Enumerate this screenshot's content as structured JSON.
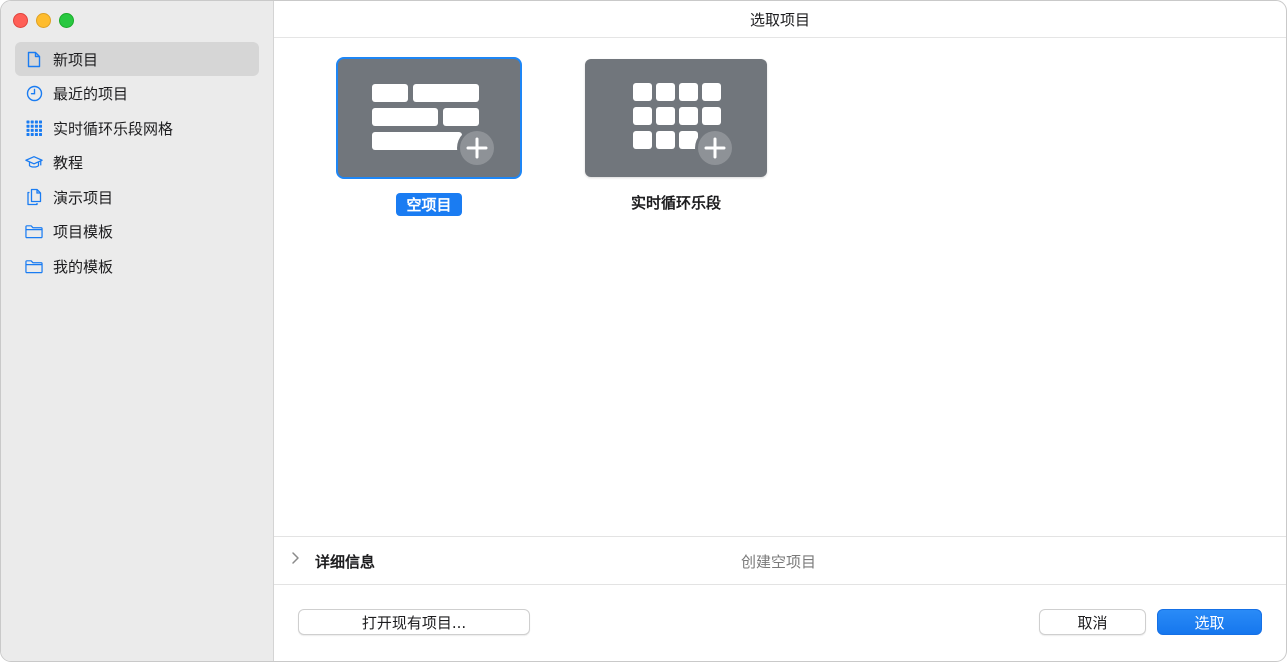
{
  "window": {
    "title": "选取项目"
  },
  "sidebar": {
    "items": [
      {
        "label": "新项目",
        "icon": "document-icon",
        "selected": true
      },
      {
        "label": "最近的项目",
        "icon": "clock-icon"
      },
      {
        "label": "实时循环乐段网格",
        "icon": "grid-icon"
      },
      {
        "label": "教程",
        "icon": "graduation-cap-icon"
      },
      {
        "label": "演示项目",
        "icon": "documents-icon"
      },
      {
        "label": "项目模板",
        "icon": "folder-icon"
      },
      {
        "label": "我的模板",
        "icon": "folder-icon"
      }
    ]
  },
  "gallery": {
    "tiles": [
      {
        "label": "空项目",
        "icon": "tracks-plus-icon",
        "selected": true
      },
      {
        "label": "实时循环乐段",
        "icon": "grid-plus-icon"
      }
    ]
  },
  "details": {
    "label": "详细信息",
    "description": "创建空项目"
  },
  "footer": {
    "open_existing_label": "打开现有项目...",
    "cancel_label": "取消",
    "choose_label": "选取"
  },
  "colors": {
    "accent": "#1a7cf2",
    "sidebar_bg": "#ebebeb",
    "thumb_bg": "#71767c"
  }
}
